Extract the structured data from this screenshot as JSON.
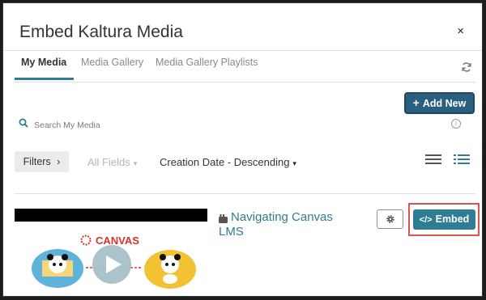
{
  "dialog": {
    "title": "Embed Kaltura Media",
    "close_symbol": "×"
  },
  "tabs": [
    {
      "label": "My Media",
      "active": true
    },
    {
      "label": "Media Gallery",
      "active": false
    },
    {
      "label": "Media Gallery Playlists",
      "active": false
    }
  ],
  "toolbar": {
    "add_new_label": "Add New",
    "add_new_symbol": "+"
  },
  "search": {
    "placeholder": "Search My Media"
  },
  "filters": {
    "filters_label": "Filters",
    "filters_symbol": "›",
    "fields_label": "All Fields",
    "sort_label": "Creation Date - Descending",
    "caret_symbol": "▾"
  },
  "media_item": {
    "title": "Navigating Canvas LMS",
    "thumbnail_logo_text": "CANVAS",
    "embed_label": "Embed",
    "embed_symbol": "</>"
  },
  "colors": {
    "accent": "#2e7d92",
    "primary_button": "#2b5f80",
    "highlight": "#d9534f"
  },
  "icons": [
    "close-icon",
    "refresh-icon",
    "plus-icon",
    "search-icon",
    "info-icon",
    "chevron-right-icon",
    "chevron-down-icon",
    "list-view-icon",
    "detail-view-icon",
    "youtube-icon",
    "play-icon",
    "gear-icon",
    "code-icon"
  ]
}
